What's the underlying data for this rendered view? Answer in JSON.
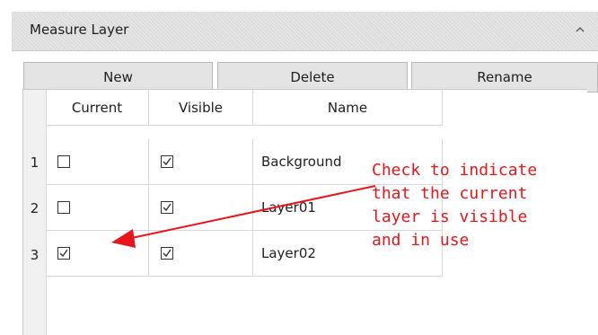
{
  "panel": {
    "title": "Measure Layer",
    "collapse_icon": "chevron-up-icon"
  },
  "toolbar": {
    "new_label": "New",
    "delete_label": "Delete",
    "rename_label": "Rename"
  },
  "table": {
    "columns": [
      "Current",
      "Visible",
      "Name"
    ],
    "rows": [
      {
        "num": "1",
        "current": false,
        "visible": true,
        "name": "Background"
      },
      {
        "num": "2",
        "current": false,
        "visible": true,
        "name": "Layer01"
      },
      {
        "num": "3",
        "current": true,
        "visible": true,
        "name": "Layer02"
      }
    ]
  },
  "annotation": {
    "line1": "Check to indicate",
    "line2": "that the current",
    "line3": "layer is visible",
    "line4": "and in use",
    "color": "#e8151b"
  }
}
